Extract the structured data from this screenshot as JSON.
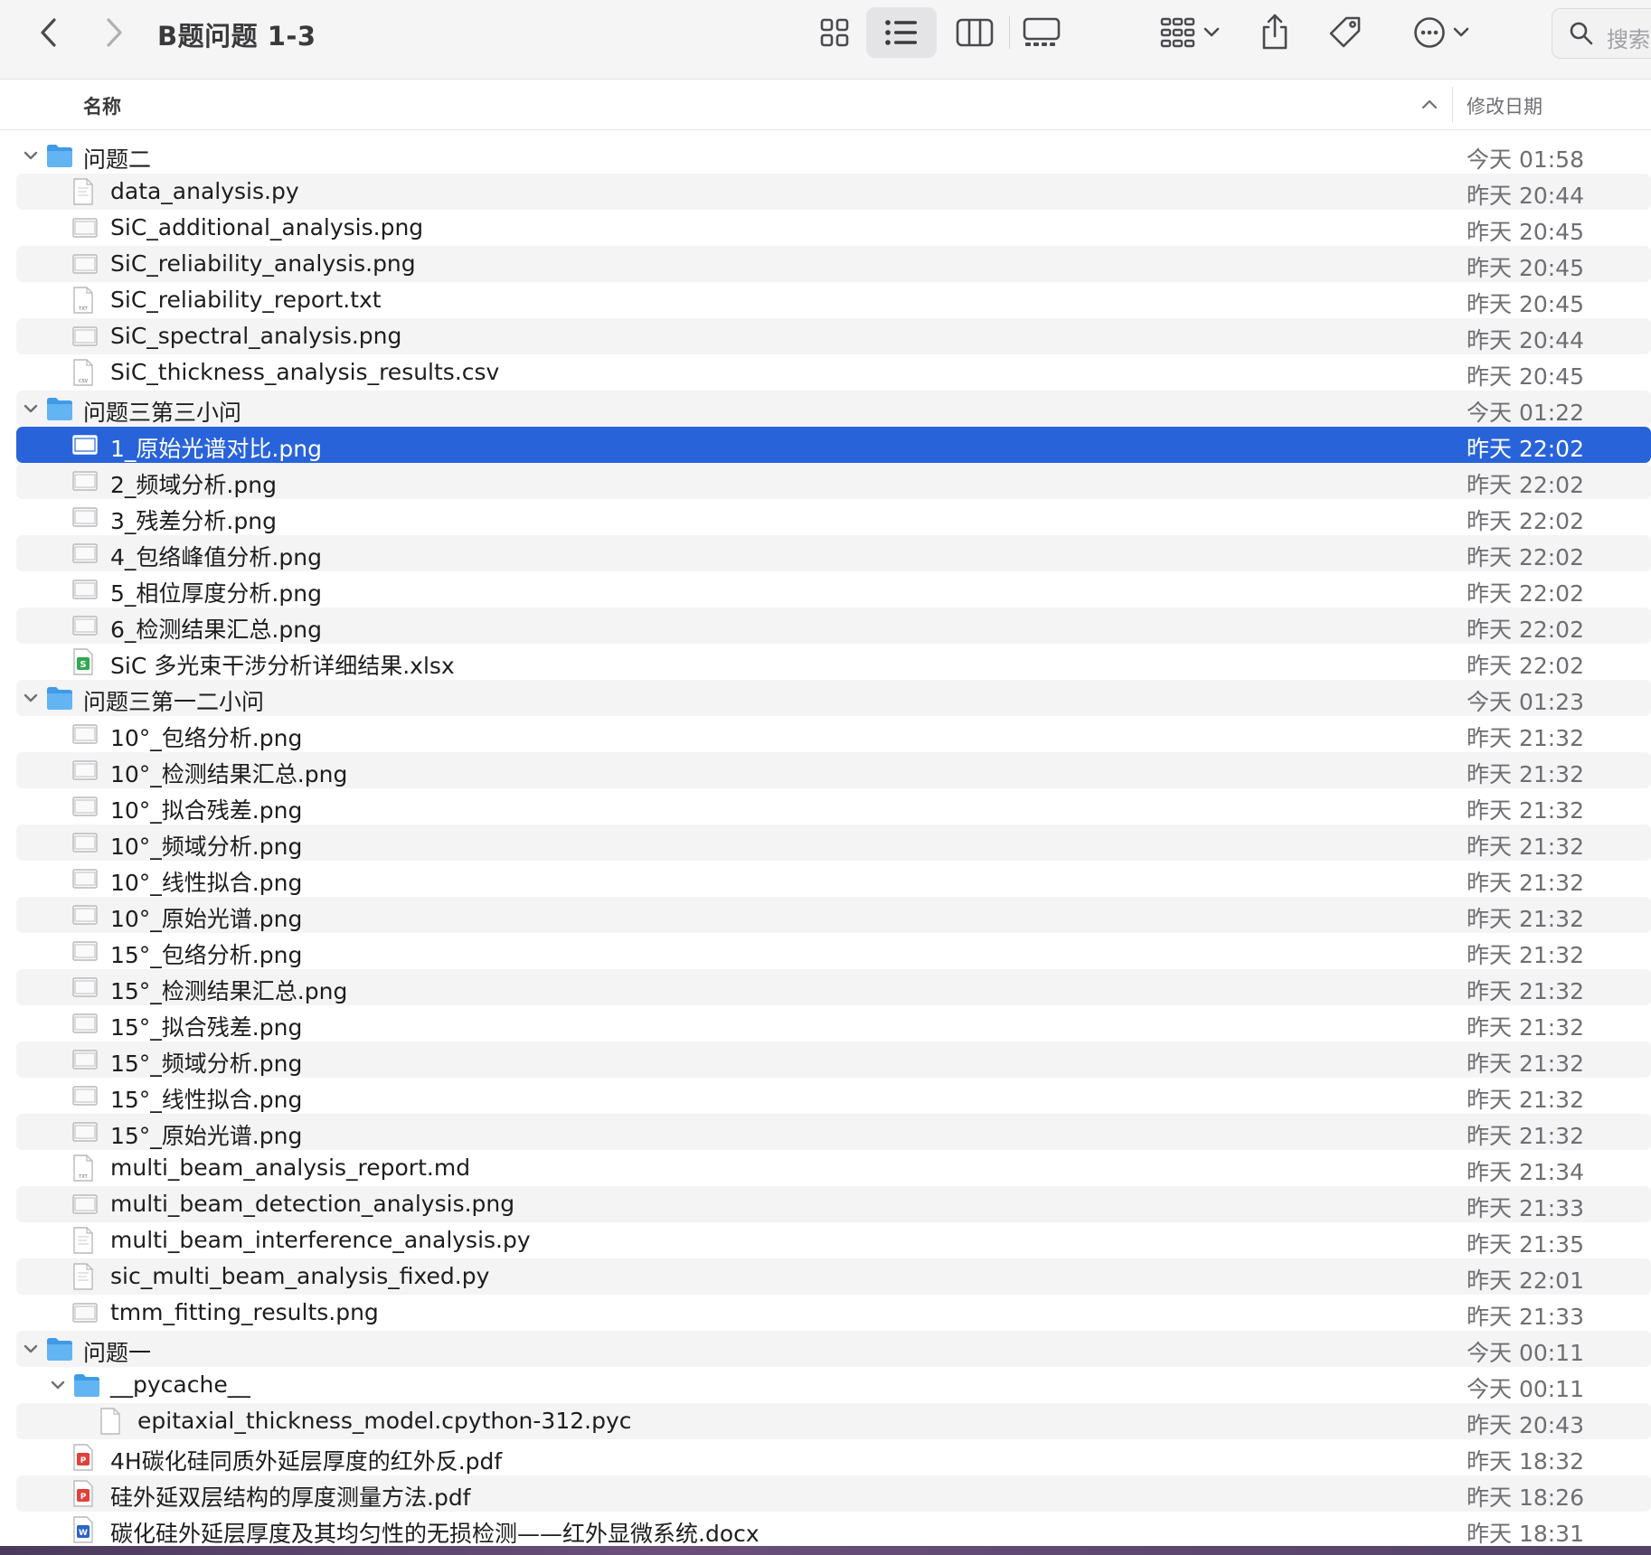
{
  "window": {
    "title": "B题问题 1-3"
  },
  "toolbar": {
    "back_icon": "chevron-left-icon",
    "forward_icon": "chevron-right-icon",
    "views": [
      "icon-view",
      "list-view",
      "column-view",
      "gallery-view"
    ],
    "active_view": "list-view",
    "search_placeholder": "搜索"
  },
  "columns": {
    "name": "名称",
    "date": "修改日期",
    "sort": "ascending"
  },
  "colors": {
    "selection": "#2863d9",
    "folder": "#5aacf0"
  },
  "rows": [
    {
      "kind": "folder",
      "level": 0,
      "name": "问题二",
      "date": "今天 01:58",
      "expanded": true
    },
    {
      "kind": "py",
      "level": 1,
      "name": "data_analysis.py",
      "date": "昨天 20:44"
    },
    {
      "kind": "png",
      "level": 1,
      "name": "SiC_additional_analysis.png",
      "date": "昨天 20:45"
    },
    {
      "kind": "png",
      "level": 1,
      "name": "SiC_reliability_analysis.png",
      "date": "昨天 20:45"
    },
    {
      "kind": "txt",
      "level": 1,
      "name": "SiC_reliability_report.txt",
      "date": "昨天 20:45"
    },
    {
      "kind": "png",
      "level": 1,
      "name": "SiC_spectral_analysis.png",
      "date": "昨天 20:44"
    },
    {
      "kind": "csv",
      "level": 1,
      "name": "SiC_thickness_analysis_results.csv",
      "date": "昨天 20:45"
    },
    {
      "kind": "folder",
      "level": 0,
      "name": "问题三第三小问",
      "date": "今天 01:22",
      "expanded": true
    },
    {
      "kind": "png",
      "level": 1,
      "name": "1_原始光谱对比.png",
      "date": "昨天 22:02",
      "selected": true
    },
    {
      "kind": "png",
      "level": 1,
      "name": "2_频域分析.png",
      "date": "昨天 22:02"
    },
    {
      "kind": "png",
      "level": 1,
      "name": "3_残差分析.png",
      "date": "昨天 22:02"
    },
    {
      "kind": "png",
      "level": 1,
      "name": "4_包络峰值分析.png",
      "date": "昨天 22:02"
    },
    {
      "kind": "png",
      "level": 1,
      "name": "5_相位厚度分析.png",
      "date": "昨天 22:02"
    },
    {
      "kind": "png",
      "level": 1,
      "name": "6_检测结果汇总.png",
      "date": "昨天 22:02"
    },
    {
      "kind": "xlsx",
      "level": 1,
      "name": "SiC 多光束干涉分析详细结果.xlsx",
      "date": "昨天 22:02"
    },
    {
      "kind": "folder",
      "level": 0,
      "name": "问题三第一二小问",
      "date": "今天 01:23",
      "expanded": true
    },
    {
      "kind": "png",
      "level": 1,
      "name": "10°_包络分析.png",
      "date": "昨天 21:32"
    },
    {
      "kind": "png",
      "level": 1,
      "name": "10°_检测结果汇总.png",
      "date": "昨天 21:32"
    },
    {
      "kind": "png",
      "level": 1,
      "name": "10°_拟合残差.png",
      "date": "昨天 21:32"
    },
    {
      "kind": "png",
      "level": 1,
      "name": "10°_频域分析.png",
      "date": "昨天 21:32"
    },
    {
      "kind": "png",
      "level": 1,
      "name": "10°_线性拟合.png",
      "date": "昨天 21:32"
    },
    {
      "kind": "png",
      "level": 1,
      "name": "10°_原始光谱.png",
      "date": "昨天 21:32"
    },
    {
      "kind": "png",
      "level": 1,
      "name": "15°_包络分析.png",
      "date": "昨天 21:32"
    },
    {
      "kind": "png",
      "level": 1,
      "name": "15°_检测结果汇总.png",
      "date": "昨天 21:32"
    },
    {
      "kind": "png",
      "level": 1,
      "name": "15°_拟合残差.png",
      "date": "昨天 21:32"
    },
    {
      "kind": "png",
      "level": 1,
      "name": "15°_频域分析.png",
      "date": "昨天 21:32"
    },
    {
      "kind": "png",
      "level": 1,
      "name": "15°_线性拟合.png",
      "date": "昨天 21:32"
    },
    {
      "kind": "png",
      "level": 1,
      "name": "15°_原始光谱.png",
      "date": "昨天 21:32"
    },
    {
      "kind": "txt",
      "level": 1,
      "name": "multi_beam_analysis_report.md",
      "date": "昨天 21:34"
    },
    {
      "kind": "png",
      "level": 1,
      "name": "multi_beam_detection_analysis.png",
      "date": "昨天 21:33"
    },
    {
      "kind": "py",
      "level": 1,
      "name": "multi_beam_interference_analysis.py",
      "date": "昨天 21:35"
    },
    {
      "kind": "py",
      "level": 1,
      "name": "sic_multi_beam_analysis_fixed.py",
      "date": "昨天 22:01"
    },
    {
      "kind": "png",
      "level": 1,
      "name": "tmm_fitting_results.png",
      "date": "昨天 21:33"
    },
    {
      "kind": "folder",
      "level": 0,
      "name": "问题一",
      "date": "今天 00:11",
      "expanded": true
    },
    {
      "kind": "folder",
      "level": 1,
      "name": "__pycache__",
      "date": "今天 00:11",
      "expanded": true
    },
    {
      "kind": "blank",
      "level": 2,
      "name": "epitaxial_thickness_model.cpython-312.pyc",
      "date": "昨天 20:43"
    },
    {
      "kind": "pdf",
      "level": 1,
      "name": "4H碳化硅同质外延层厚度的红外反.pdf",
      "date": "昨天 18:32"
    },
    {
      "kind": "pdf",
      "level": 1,
      "name": "硅外延双层结构的厚度测量方法.pdf",
      "date": "昨天 18:26"
    },
    {
      "kind": "docx",
      "level": 1,
      "name": "碳化硅外延层厚度及其均匀性的无损检测——红外显微系统.docx",
      "date": "昨天 18:31"
    }
  ]
}
